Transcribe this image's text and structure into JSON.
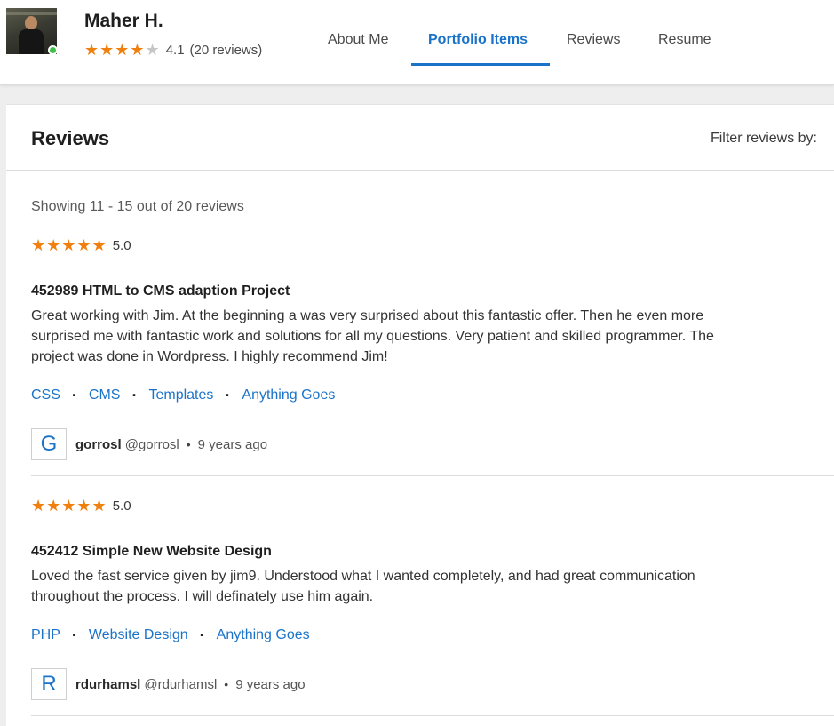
{
  "profile": {
    "name": "Maher H.",
    "rating": "4.1",
    "review_count": "(20 reviews)",
    "stars_filled": 4,
    "stars_total": 5
  },
  "nav": {
    "tabs": [
      "About Me",
      "Portfolio Items",
      "Reviews",
      "Resume"
    ],
    "active": "Portfolio Items"
  },
  "reviews_section": {
    "title": "Reviews",
    "filter_label": "Filter reviews by:",
    "showing": "Showing 11 - 15 out of 20 reviews"
  },
  "reviews": [
    {
      "rating": "5.0",
      "title": "452989 HTML to CMS adaption Project",
      "body": "Great working with Jim. At the beginning a was very surprised about this fantastic offer. Then he even more surprised me with fantastic work and solutions for all my questions. Very patient and skilled programmer. The project was done in Wordpress. I highly recommend Jim!",
      "tags": [
        "CSS",
        "CMS",
        "Templates",
        "Anything Goes"
      ],
      "reviewer_initial": "G",
      "reviewer_name": "gorrosl",
      "reviewer_handle": "@gorrosl",
      "time": "9 years ago"
    },
    {
      "rating": "5.0",
      "title": "452412 Simple New Website Design",
      "body": "Loved the fast service given by jim9. Understood what I wanted completely, and had great communication throughout the process. I will definately use him again.",
      "tags": [
        "PHP",
        "Website Design",
        "Anything Goes"
      ],
      "reviewer_initial": "R",
      "reviewer_name": "rdurhamsl",
      "reviewer_handle": "@rdurhamsl",
      "time": "9 years ago"
    }
  ],
  "colors": {
    "accent": "#1a73c9",
    "star": "#f07f0d",
    "online": "#3fbf48"
  }
}
